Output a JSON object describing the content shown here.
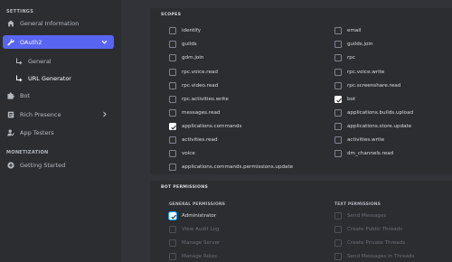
{
  "sidebar": {
    "settings_label": "SETTINGS",
    "items": [
      {
        "label": "General Information",
        "icon": "home-icon"
      },
      {
        "label": "OAuth2",
        "icon": "wrench-icon"
      },
      {
        "label": "General",
        "icon": "subitem-arrow-icon"
      },
      {
        "label": "URL Generator",
        "icon": "subitem-arrow-icon"
      },
      {
        "label": "Bot",
        "icon": "puzzle-icon"
      },
      {
        "label": "Rich Presence",
        "icon": "document-icon"
      },
      {
        "label": "App Testers",
        "icon": "user-check-icon"
      }
    ],
    "monetization_label": "MONETIZATION",
    "getting_started": {
      "label": "Getting Started",
      "icon": "plus-circle-icon"
    }
  },
  "scopes": {
    "title": "SCOPES",
    "left": [
      {
        "label": "identify",
        "checked": false
      },
      {
        "label": "guilds",
        "checked": false
      },
      {
        "label": "gdm.join",
        "checked": false
      },
      {
        "label": "rpc.voice.read",
        "checked": false
      },
      {
        "label": "rpc.video.read",
        "checked": false
      },
      {
        "label": "rpc.activities.write",
        "checked": false
      },
      {
        "label": "messages.read",
        "checked": false
      },
      {
        "label": "applications.commands",
        "checked": true
      },
      {
        "label": "activities.read",
        "checked": false
      },
      {
        "label": "voice",
        "checked": false
      },
      {
        "label": "applications.commands.permissions.update",
        "checked": false
      }
    ],
    "right": [
      {
        "label": "email",
        "checked": false
      },
      {
        "label": "guilds.join",
        "checked": false
      },
      {
        "label": "rpc",
        "checked": false
      },
      {
        "label": "rpc.voice.write",
        "checked": false
      },
      {
        "label": "rpc.screenshare.read",
        "checked": false
      },
      {
        "label": "bot",
        "checked": true
      },
      {
        "label": "applications.builds.upload",
        "checked": false
      },
      {
        "label": "applications.store.update",
        "checked": false
      },
      {
        "label": "activities.write",
        "checked": false
      },
      {
        "label": "dm_channels.read",
        "checked": false
      }
    ]
  },
  "bot_permissions": {
    "title": "BOT PERMISSIONS",
    "general_title": "GENERAL PERMISSIONS",
    "text_title": "TEXT PERMISSIONS",
    "general": [
      {
        "label": "Administrator",
        "checked": true
      },
      {
        "label": "View Audit Log",
        "checked": false
      },
      {
        "label": "Manage Server",
        "checked": false
      },
      {
        "label": "Manage Roles",
        "checked": false
      }
    ],
    "text": [
      {
        "label": "Send Messages",
        "checked": false
      },
      {
        "label": "Create Public Threads",
        "checked": false
      },
      {
        "label": "Create Private Threads",
        "checked": false
      },
      {
        "label": "Send Messages in Threads",
        "checked": false
      }
    ]
  },
  "colors": {
    "accent": "#5865f2",
    "sidebar_bg": "#2b2d31",
    "main_bg": "#313338",
    "admin_outline": "#00a8fc"
  }
}
